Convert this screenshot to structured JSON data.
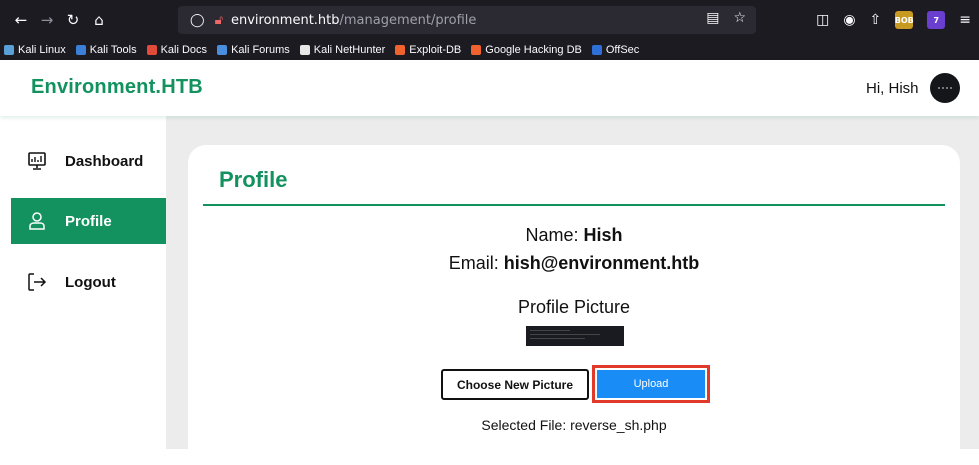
{
  "browser": {
    "url_host": "environment.htb",
    "url_path": "/management/profile",
    "bookmarks": [
      "Kali Linux",
      "Kali Tools",
      "Kali Docs",
      "Kali Forums",
      "Kali NetHunter",
      "Exploit-DB",
      "Google Hacking DB",
      "OffSec"
    ],
    "extension_badges": [
      "BOB",
      "7"
    ]
  },
  "header": {
    "brand": "Environment.HTB",
    "greeting": "Hi, Hish"
  },
  "sidebar": {
    "items": [
      {
        "label": "Dashboard",
        "icon": "dashboard-monitor-icon"
      },
      {
        "label": "Profile",
        "icon": "user-icon",
        "active": true
      },
      {
        "label": "Logout",
        "icon": "logout-icon"
      }
    ]
  },
  "profile": {
    "title": "Profile",
    "name_label": "Name:",
    "name_value": "Hish",
    "email_label": "Email:",
    "email_value": "hish@environment.htb",
    "picture_heading": "Profile Picture",
    "choose_button": "Choose New Picture",
    "upload_button": "Upload",
    "selected_file": "Selected File: reverse_sh.php"
  },
  "colors": {
    "brand_green": "#13925f",
    "upload_blue": "#1a8cf5",
    "highlight_red": "#e23a2a"
  }
}
